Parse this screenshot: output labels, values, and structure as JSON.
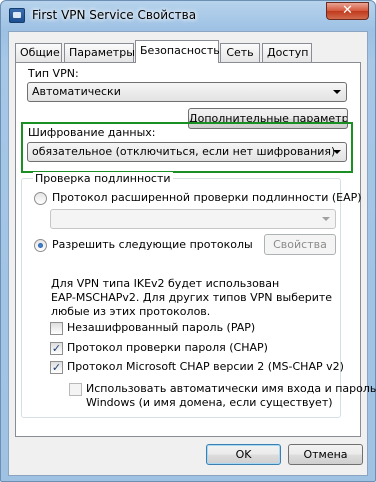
{
  "window": {
    "title": "First VPN Service Свойства",
    "close_glyph": "✕"
  },
  "tabs": [
    {
      "label": "Общие",
      "active": false
    },
    {
      "label": "Параметры",
      "active": false
    },
    {
      "label": "Безопасность",
      "active": true
    },
    {
      "label": "Сеть",
      "active": false
    },
    {
      "label": "Доступ",
      "active": false
    }
  ],
  "vpn_type": {
    "label": "Тип VPN:",
    "value": "Автоматически"
  },
  "advanced_button": "Дополнительные параметры",
  "encryption": {
    "label": "Шифрование данных:",
    "value": "обязательное (отключиться, если нет шифрования)",
    "highlight_color": "#1a8f24"
  },
  "authentication": {
    "group_title": "Проверка подлинности",
    "eap_radio_label": "Протокол расширенной проверки подлинности (EAP)",
    "eap_combo_value": "",
    "allow_radio_label": "Разрешить следующие протоколы",
    "properties_button": "Свойства",
    "info_lines": [
      "Для VPN типа IKEv2 будет использован",
      "EAP-MSCHAPv2. Для других типов VPN выберите",
      "любые из этих протоколов."
    ],
    "protocols": [
      {
        "label": "Незашифрованный пароль (PAP)",
        "checked": false
      },
      {
        "label": "Протокол проверки пароля (CHAP)",
        "checked": true
      },
      {
        "label": "Протокол Microsoft CHAP версии 2 (MS-CHAP v2)",
        "checked": true
      }
    ],
    "auto_logon": {
      "lines": [
        "Использовать автоматически имя входа и пароль",
        "Windows (и имя домена, если существует)"
      ],
      "checked": false
    }
  },
  "buttons": {
    "ok": "OK",
    "cancel": "Отмена"
  }
}
